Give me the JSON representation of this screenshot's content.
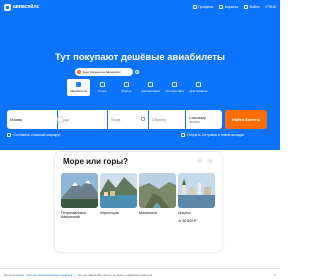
{
  "colors": {
    "brand": "#0c73fe",
    "accent": "#ff6d00",
    "text": "#141414"
  },
  "header": {
    "logo_text": "авиасейлс",
    "nav": [
      {
        "label": "Профиль",
        "icon": "profile-icon"
      },
      {
        "label": "Корзина",
        "icon": "cart-icon"
      },
      {
        "label": "Войти",
        "icon": "login-icon"
      }
    ],
    "currency": "₽ RUB"
  },
  "hero": {
    "headline": "Тут покупают дешёвые авиабилеты",
    "promo_pill": "Ещё больше на Авиасейлс",
    "tabs": [
      {
        "label": "Авиабилеты",
        "icon": "plane-icon",
        "active": true
      },
      {
        "label": "Отели",
        "icon": "hotel-icon"
      },
      {
        "label": "Короче",
        "icon": "pin-icon"
      },
      {
        "label": "Аэроэкспресс",
        "icon": "train-icon"
      },
      {
        "label": "Путешествия",
        "icon": "globe-icon"
      },
      {
        "label": "Для бизнеса",
        "icon": "briefcase-icon"
      }
    ]
  },
  "search": {
    "origin_value": "Москва",
    "destination_placeholder": "Куда",
    "depart_placeholder": "Когда",
    "return_placeholder": "Обратно",
    "passengers": "1 пассажир",
    "cabin": "эконом",
    "submit_label": "Найти билеты"
  },
  "options": {
    "compose_route": "Составить сложный маршрут",
    "open_booking": "Открыть Островок в новой вкладке"
  },
  "card": {
    "title": "Море или горы?",
    "items": [
      {
        "city": "Петропавловск-Камчатский",
        "price": ""
      },
      {
        "city": "Черногория",
        "price": ""
      },
      {
        "city": "Махачкала",
        "price": ""
      },
      {
        "city": "Иркутск",
        "price": "от 80 800 ₽"
      }
    ]
  },
  "cookie_bar": {
    "text": "Мы используем",
    "link": "куки для персонализации сервисов",
    "tail": "— без них Авиасейлс просто не может нормально работать"
  }
}
